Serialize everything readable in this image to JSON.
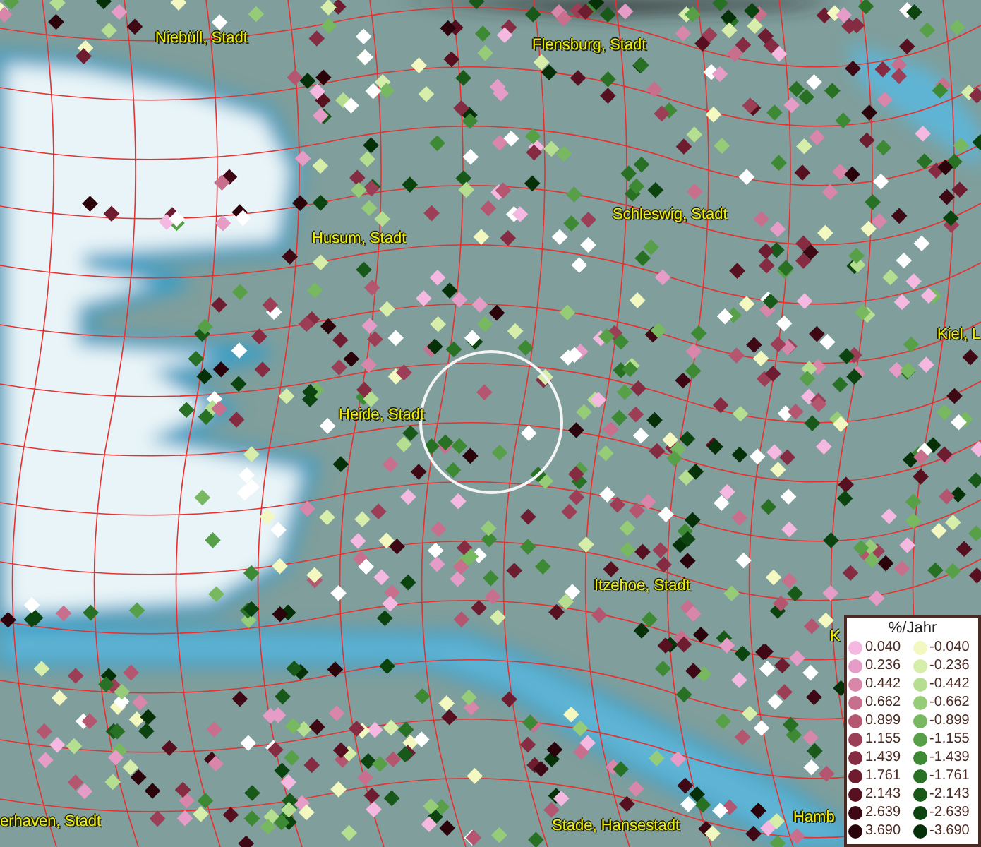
{
  "map": {
    "place_labels": [
      "Niebüll, Stadt",
      "Flensburg, Stadt",
      "Schleswig, Stadt",
      "Husum, Stadt",
      "Kiel, L",
      "Heide, Stadt",
      "Itzehoe, Stadt",
      "K",
      "Stade, Hansestadt",
      "Hamb",
      "erhaven, Stadt"
    ]
  },
  "legend": {
    "title": "%/Jahr",
    "rows": [
      {
        "positive": {
          "label": "0.040",
          "color": "#f5b8e0"
        },
        "negative": {
          "label": "-0.040",
          "color": "#f2f8c0"
        }
      },
      {
        "positive": {
          "label": "0.236",
          "color": "#e59cc6"
        },
        "negative": {
          "label": "-0.236",
          "color": "#d6eeaa"
        }
      },
      {
        "positive": {
          "label": "0.442",
          "color": "#d886aa"
        },
        "negative": {
          "label": "-0.442",
          "color": "#b6de90"
        }
      },
      {
        "positive": {
          "label": "0.662",
          "color": "#c96f8e"
        },
        "negative": {
          "label": "-0.662",
          "color": "#96cc78"
        }
      },
      {
        "positive": {
          "label": "0.899",
          "color": "#b45670"
        },
        "negative": {
          "label": "-0.899",
          "color": "#78b860"
        }
      },
      {
        "positive": {
          "label": "1.155",
          "color": "#9c3e56"
        },
        "negative": {
          "label": "-1.155",
          "color": "#58a048"
        }
      },
      {
        "positive": {
          "label": "1.439",
          "color": "#862c42"
        },
        "negative": {
          "label": "-1.439",
          "color": "#3e8a34"
        }
      },
      {
        "positive": {
          "label": "1.761",
          "color": "#6e1c30"
        },
        "negative": {
          "label": "-1.761",
          "color": "#287024"
        }
      },
      {
        "positive": {
          "label": "2.143",
          "color": "#561020"
        },
        "negative": {
          "label": "-2.143",
          "color": "#185818"
        }
      },
      {
        "positive": {
          "label": "2.639",
          "color": "#3e0814"
        },
        "negative": {
          "label": "-2.639",
          "color": "#0c4410"
        }
      },
      {
        "positive": {
          "label": "3.690",
          "color": "#2a040a"
        },
        "negative": {
          "label": "-3.690",
          "color": "#063008"
        }
      }
    ]
  }
}
